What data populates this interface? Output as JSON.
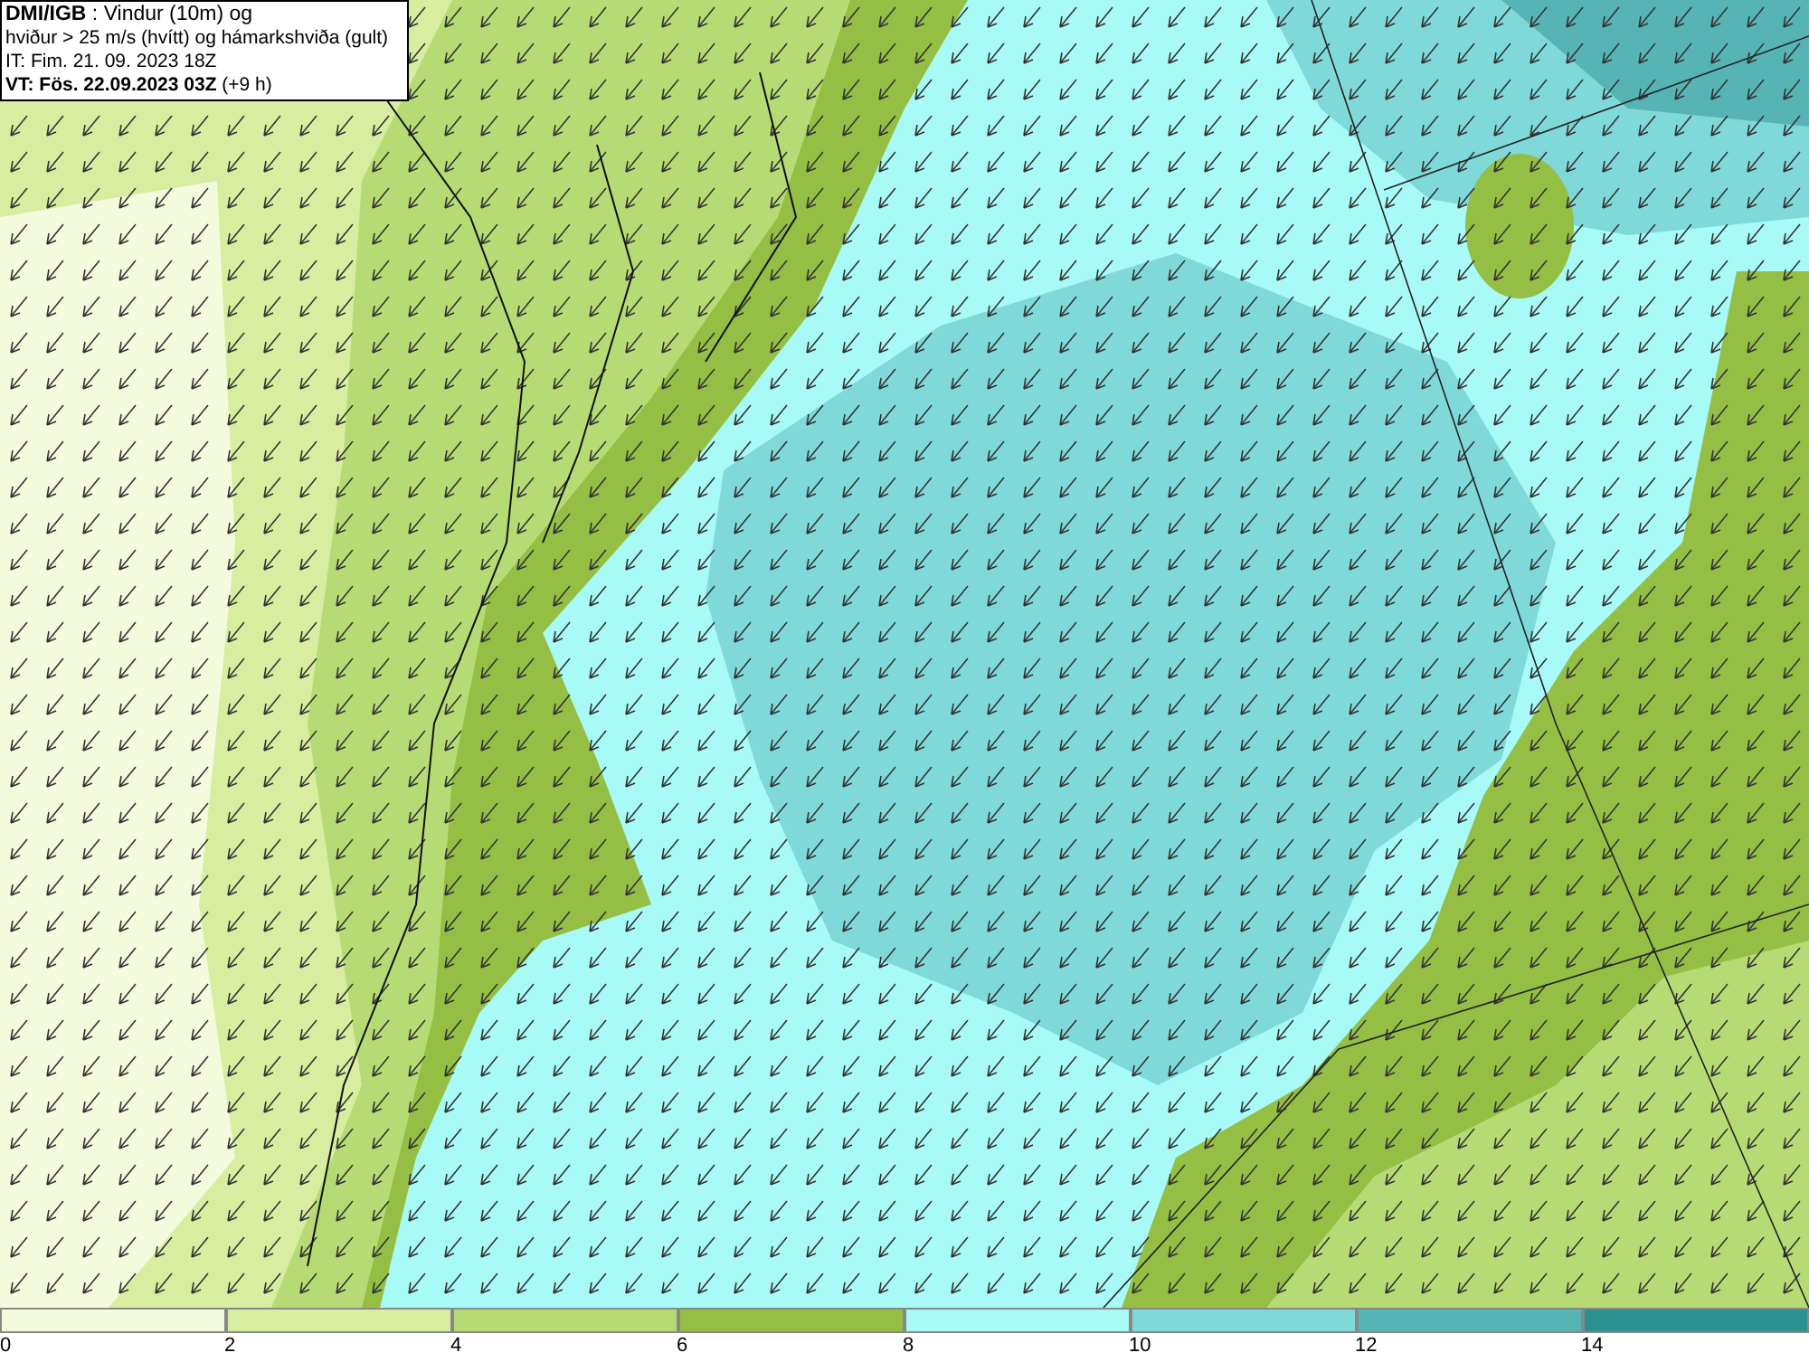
{
  "header": {
    "lines": [
      "**DMI/IGB** : Vindur (10m) og",
      "hviður > 25 m/s (hvítt) og hámarkshviða (gult)",
      "IT: Fim. 21. 09. 2023 18Z",
      "**VT: Fös. 22.09.2023 03Z** (+9 h)"
    ]
  },
  "legend": {
    "bins": [
      {
        "label": "0",
        "color": "#f4fadc"
      },
      {
        "label": "2",
        "color": "#d8ed9f"
      },
      {
        "label": "4",
        "color": "#b7db74"
      },
      {
        "label": "6",
        "color": "#94be44"
      },
      {
        "label": "8",
        "color": "#a8faf6"
      },
      {
        "label": "10",
        "color": "#80d9d9"
      },
      {
        "label": "12",
        "color": "#56b4b4"
      },
      {
        "label": "14",
        "color": "#2a918e"
      }
    ]
  }
}
